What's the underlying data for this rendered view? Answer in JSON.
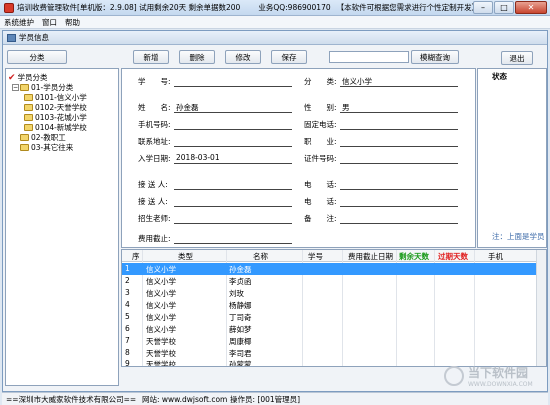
{
  "window": {
    "title": "培训收费管理软件[单机版：2.9.08]  试用剩余20天  剩余单据数200",
    "qq": "业务QQ:986900170",
    "notice": "【本软件可根据您需求进行个性定制开发】",
    "minimize": "–",
    "maximize": "□",
    "close": "✕"
  },
  "menu": [
    "系统维护",
    "窗口",
    "帮助"
  ],
  "child_window": {
    "title": "学员信息"
  },
  "toolbar": {
    "classify": "分类",
    "add": "新增",
    "delete": "删除",
    "edit": "修改",
    "save": "保存",
    "search_value": "",
    "fuzzy_search": "模糊查询",
    "exit": "退出"
  },
  "tree": {
    "root": "学员分类",
    "nodes": [
      {
        "label": "01-学员分类"
      },
      {
        "label": "0101-信义小学"
      },
      {
        "label": "0102-天誉学校"
      },
      {
        "label": "0103-花城小学"
      },
      {
        "label": "0104-新城学校"
      },
      {
        "label": "02-教职工"
      },
      {
        "label": "03-其它往来"
      }
    ]
  },
  "form": {
    "student_no_label": "学　　号:",
    "student_no": "",
    "category_label": "分　　类:",
    "category": "信义小学",
    "name_label": "姓　　名:",
    "name": "孙金磊",
    "gender_label": "性　　别:",
    "gender": "男",
    "mobile_label": "手机号码:",
    "phone_label": "固定电话:",
    "address_label": "联系地址:",
    "job_label": "职　　业:",
    "enroll_label": "入学日期:",
    "enroll_date": "2018-03-01",
    "id_label": "证件号码:",
    "pickup1_label": "接 送 人:",
    "tel1_label": "电　　话:",
    "pickup2_label": "接 送 人:",
    "tel2_label": "电　　话:",
    "teacher_label": "招生老师:",
    "note_label": "备　　注:",
    "deadline_label": "费用截止:"
  },
  "status_panel": {
    "title": "状态",
    "hint": "注：上面是学员"
  },
  "table": {
    "headers": [
      "序",
      "类型",
      "名称",
      "学号",
      "费用截止日期",
      "剩余天数",
      "过期天数",
      "手机"
    ],
    "rows": [
      {
        "no": "1",
        "type": "信义小学",
        "name": "孙金磊"
      },
      {
        "no": "2",
        "type": "信义小学",
        "name": "李贞函"
      },
      {
        "no": "3",
        "type": "信义小学",
        "name": "刘玫"
      },
      {
        "no": "4",
        "type": "信义小学",
        "name": "杨静娜"
      },
      {
        "no": "5",
        "type": "信义小学",
        "name": "丁司奇"
      },
      {
        "no": "6",
        "type": "信义小学",
        "name": "薛如梦"
      },
      {
        "no": "7",
        "type": "天誉学校",
        "name": "周康椰"
      },
      {
        "no": "8",
        "type": "天誉学校",
        "name": "李司君"
      },
      {
        "no": "9",
        "type": "天誉学校",
        "name": "孙蒙蒙"
      }
    ]
  },
  "statusbar": {
    "company": "==深圳市大威家软件技术有限公司==",
    "website": "网站: www.dwjsoft.com",
    "operator": "操作员: [001管理员]"
  },
  "watermark": {
    "text": "当下软件园",
    "sub": "WWW.DOWNXIA.COM"
  },
  "colors": {
    "remaining": "#1a9a1a",
    "expired": "#e02020",
    "selection": "#3399ff"
  }
}
